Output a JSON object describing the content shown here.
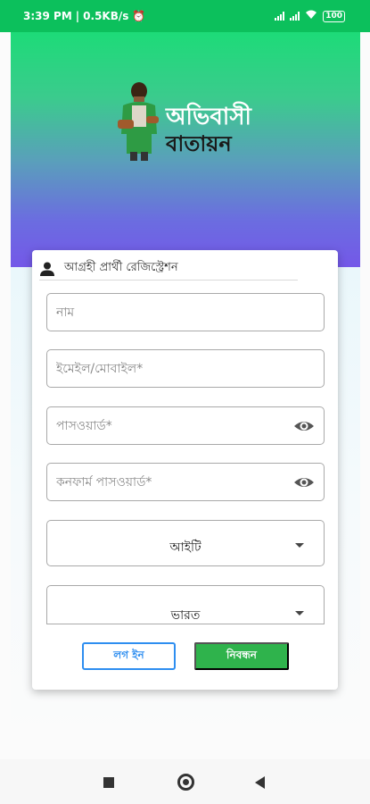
{
  "status_bar": {
    "time": "3:39 PM",
    "network_speed": "0.5KB/s",
    "battery": "100"
  },
  "header": {
    "logo_line1": "অভিবাসী",
    "logo_line2": "বাতায়ন",
    "gradient_top": "#1ddb78",
    "gradient_bottom": "#7458e8"
  },
  "form": {
    "title": "আগ্রহী প্রার্থী রেজিস্ট্রেশন",
    "name_placeholder": "নাম",
    "email_placeholder": "ইমেইল/মোবাইল*",
    "password_placeholder": "পাসওয়ার্ড*",
    "confirm_password_placeholder": "কনফার্ম পাসওয়ার্ড*",
    "category_selected": "আইটি",
    "country_selected": "ভারত",
    "login_label": "লগ ইন",
    "register_label": "নিবন্ধন"
  },
  "colors": {
    "status_bar": "#0cc05c",
    "login_border": "#2e8ef0",
    "register_bg": "#2fb34c"
  },
  "icons": [
    "user-icon",
    "eye-icon",
    "chevron-down-icon",
    "square-icon",
    "circle-icon",
    "back-icon"
  ]
}
